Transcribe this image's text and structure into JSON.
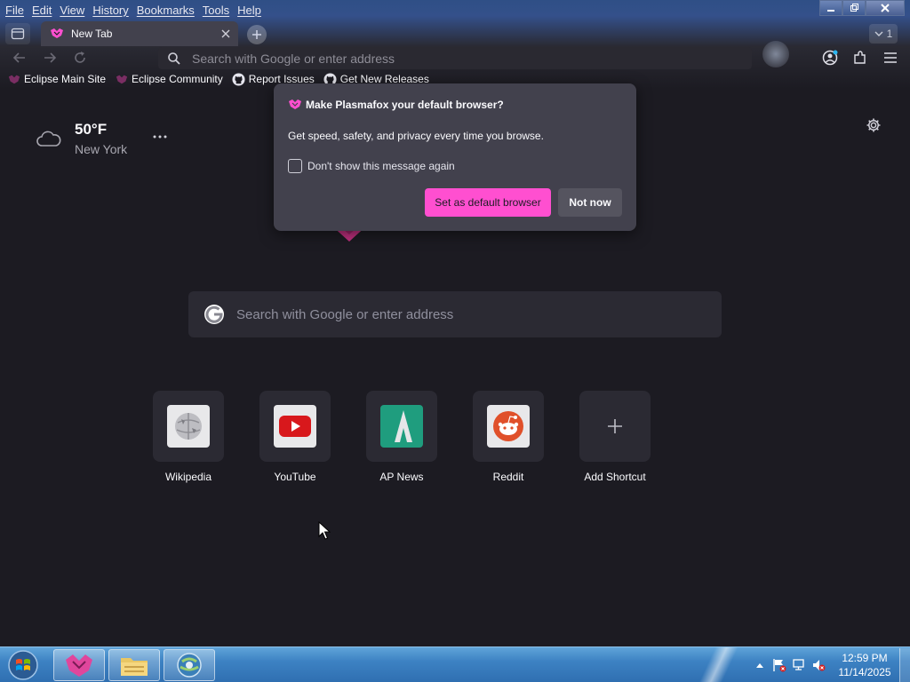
{
  "menu": [
    "File",
    "Edit",
    "View",
    "History",
    "Bookmarks",
    "Tools",
    "Help"
  ],
  "tab": {
    "title": "New Tab"
  },
  "tab_count": "1",
  "urlbar": {
    "placeholder": "Search with Google or enter address"
  },
  "bookmarks": [
    {
      "label": "Eclipse Main Site",
      "icon": "plasmafox-icon"
    },
    {
      "label": "Eclipse Community",
      "icon": "plasmafox-icon"
    },
    {
      "label": "Report Issues",
      "icon": "github-icon"
    },
    {
      "label": "Get New Releases",
      "icon": "github-icon"
    }
  ],
  "weather": {
    "temp": "50°F",
    "city": "New York",
    "icon": "cloud-icon"
  },
  "search": {
    "placeholder": "Search with Google or enter address"
  },
  "shortcuts": [
    {
      "label": "Wikipedia",
      "icon": "wikipedia-icon"
    },
    {
      "label": "YouTube",
      "icon": "youtube-icon"
    },
    {
      "label": "AP News",
      "icon": "apnews-icon"
    },
    {
      "label": "Reddit",
      "icon": "reddit-icon"
    },
    {
      "label": "Add Shortcut",
      "icon": "plus-icon"
    }
  ],
  "popup": {
    "title": "Make Plasmafox your default browser?",
    "body": "Get speed, safety, and privacy every time you browse.",
    "checkbox_label": "Don't show this message again",
    "primary_button": "Set as default browser",
    "secondary_button": "Not now"
  },
  "taskbar": {
    "time": "12:59 PM",
    "date": "11/14/2025"
  },
  "colors": {
    "accent": "#ff4fd0",
    "page_bg": "#1c1b22",
    "tile_bg": "#2b2a33",
    "popup_bg": "#42414d"
  }
}
